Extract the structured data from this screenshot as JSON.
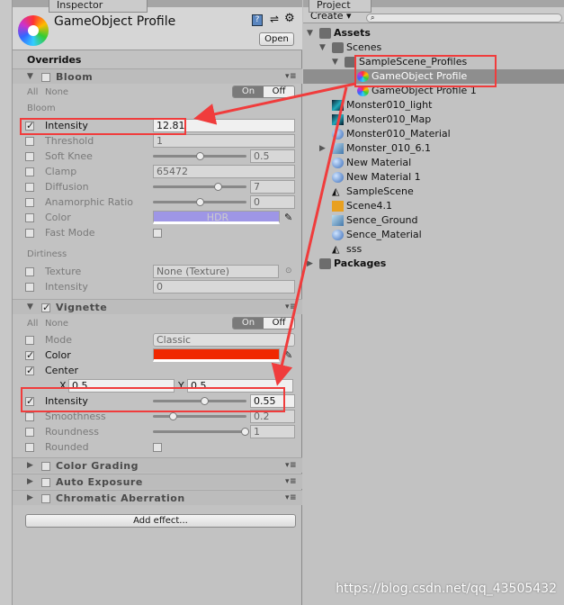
{
  "inspector": {
    "tab": "Inspector",
    "title": "GameObject Profile",
    "open_button": "Open",
    "overrides": "Overrides",
    "add_effect": "Add effect..."
  },
  "bloom": {
    "title": "Bloom",
    "all": "All",
    "none": "None",
    "on": "On",
    "off": "Off",
    "group": "Bloom",
    "dirt_group": "Dirtiness",
    "rows": [
      {
        "label": "Intensity",
        "checked": true,
        "kind": "field",
        "value": "12.81"
      },
      {
        "label": "Threshold",
        "checked": false,
        "kind": "field",
        "value": "1"
      },
      {
        "label": "Soft Knee",
        "checked": false,
        "kind": "slider",
        "value": "0.5",
        "level": 0.5
      },
      {
        "label": "Clamp",
        "checked": false,
        "kind": "field",
        "value": "65472"
      },
      {
        "label": "Diffusion",
        "checked": false,
        "kind": "slider",
        "value": "7",
        "level": 0.7
      },
      {
        "label": "Anamorphic Ratio",
        "checked": false,
        "kind": "slider",
        "value": "0",
        "level": 0.5
      },
      {
        "label": "Color",
        "checked": false,
        "kind": "color",
        "value": "HDR",
        "color": "#9e96e6"
      },
      {
        "label": "Fast Mode",
        "checked": false,
        "kind": "bool",
        "value": ""
      }
    ],
    "dirt_rows": [
      {
        "label": "Texture",
        "checked": false,
        "kind": "object",
        "value": "None (Texture)"
      },
      {
        "label": "Intensity",
        "checked": false,
        "kind": "field",
        "value": "0"
      }
    ]
  },
  "vignette": {
    "title": "Vignette",
    "all": "All",
    "none": "None",
    "on": "On",
    "off": "Off",
    "rows": [
      {
        "label": "Mode",
        "checked": false,
        "kind": "dropdown",
        "value": "Classic"
      },
      {
        "label": "Color",
        "checked": true,
        "kind": "color",
        "value": "",
        "color": "#f02800"
      },
      {
        "label": "Center",
        "checked": true,
        "kind": "none",
        "value": ""
      },
      {
        "label": "",
        "checked": null,
        "kind": "xy",
        "x_label": "X",
        "x": "0.5",
        "y_label": "Y",
        "y": "0.5"
      },
      {
        "label": "Intensity",
        "checked": true,
        "kind": "slider",
        "value": "0.55",
        "level": 0.55
      },
      {
        "label": "Smoothness",
        "checked": false,
        "kind": "slider",
        "value": "0.2",
        "level": 0.2
      },
      {
        "label": "Roundness",
        "checked": false,
        "kind": "slider",
        "value": "1",
        "level": 1
      },
      {
        "label": "Rounded",
        "checked": false,
        "kind": "bool",
        "value": ""
      }
    ]
  },
  "collapsed_effects": [
    "Color Grading",
    "Auto Exposure",
    "Chromatic Aberration"
  ],
  "project": {
    "tab": "Project",
    "create": "Create",
    "items": [
      {
        "label": "Assets",
        "depth": 0,
        "icon": "folder",
        "expanded": true,
        "bold": true
      },
      {
        "label": "Scenes",
        "depth": 1,
        "icon": "folder",
        "expanded": true
      },
      {
        "label": "SampleScene_Profiles",
        "depth": 2,
        "icon": "folder",
        "expanded": true
      },
      {
        "label": "GameObject Profile",
        "depth": 3,
        "icon": "profile",
        "selected": true
      },
      {
        "label": "GameObject Profile 1",
        "depth": 3,
        "icon": "profile"
      },
      {
        "label": "Monster010_light",
        "depth": 1,
        "icon": "texture"
      },
      {
        "label": "Monster010_Map",
        "depth": 1,
        "icon": "texture"
      },
      {
        "label": "Monster010_Material",
        "depth": 1,
        "icon": "material"
      },
      {
        "label": "Monster_010_6.1",
        "depth": 1,
        "icon": "model",
        "collapsed": true
      },
      {
        "label": "New Material",
        "depth": 1,
        "icon": "material"
      },
      {
        "label": "New Material 1",
        "depth": 1,
        "icon": "material"
      },
      {
        "label": "SampleScene",
        "depth": 1,
        "icon": "unity"
      },
      {
        "label": "Scene4.1",
        "depth": 1,
        "icon": "lightingdata"
      },
      {
        "label": "Sence_Ground",
        "depth": 1,
        "icon": "model"
      },
      {
        "label": "Sence_Material",
        "depth": 1,
        "icon": "material"
      },
      {
        "label": "sss",
        "depth": 1,
        "icon": "unity"
      },
      {
        "label": "Packages",
        "depth": 0,
        "icon": "folder",
        "collapsed": true,
        "bold": true
      }
    ]
  },
  "watermark": "https://blog.csdn.net/qq_43505432",
  "colors": {
    "annotation": "#f03c3c",
    "selection": "#8e8e8e"
  }
}
